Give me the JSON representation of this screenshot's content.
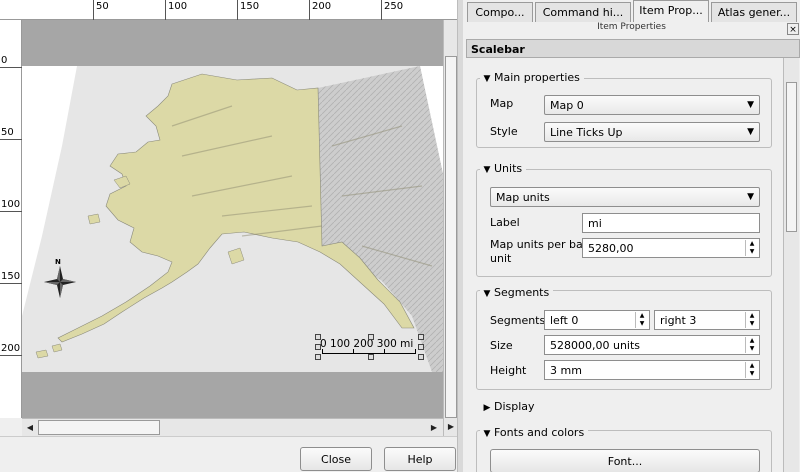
{
  "ruler_top": {
    "labels": [
      "50",
      "100",
      "150",
      "200",
      "250"
    ]
  },
  "ruler_left": {
    "labels": [
      "0",
      "50",
      "100",
      "150",
      "200"
    ]
  },
  "map": {
    "north_arrow_label": "N",
    "scalebar_labels": "0  100 200 300 mi"
  },
  "buttons": {
    "close": "Close",
    "help": "Help"
  },
  "dock": {
    "tabs": [
      "Compo...",
      "Command hi...",
      "Item Prop...",
      "Atlas gener..."
    ],
    "active_tab": "Item Prop...",
    "title": "Item Properties",
    "close_glyph": "×",
    "section_title": "Scalebar",
    "main_properties": {
      "header": "Main properties",
      "map_label": "Map",
      "map_value": "Map 0",
      "style_label": "Style",
      "style_value": "Line Ticks Up"
    },
    "units": {
      "header": "Units",
      "units_value": "Map units",
      "label_label": "Label",
      "label_value": "mi",
      "per_bar_label_1": "Map units per bar",
      "per_bar_label_2": "unit",
      "per_bar_value": "5280,00"
    },
    "segments": {
      "header": "Segments",
      "segments_label": "Segments",
      "left_value": "left 0",
      "right_value": "right 3",
      "size_label": "Size",
      "size_value": "528000,00 units",
      "height_label": "Height",
      "height_value": "3 mm"
    },
    "display": {
      "header": "Display"
    },
    "fonts_colors": {
      "header": "Fonts and colors",
      "font_button": "Font..."
    }
  },
  "colors": {
    "land": "#dcd9a6",
    "hillshade_area": "#c8c8c8",
    "map_background": "#e8e8e8",
    "canvas_gray": "#a6a6a6"
  }
}
